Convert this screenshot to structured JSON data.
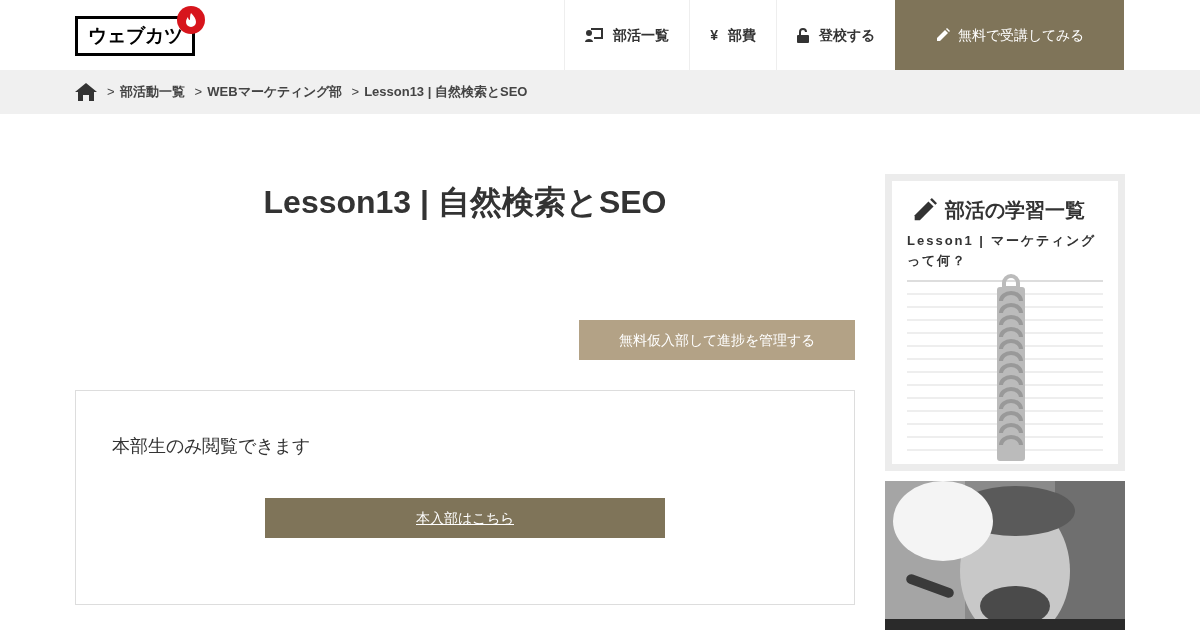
{
  "logo": {
    "text": "ウェブカツ"
  },
  "nav": [
    {
      "kind": "list",
      "label": "部活一覧"
    },
    {
      "kind": "yen",
      "glyph": "¥",
      "label": "部費"
    },
    {
      "kind": "lock",
      "label": "登校する"
    },
    {
      "kind": "cta",
      "label": "無料で受講してみる"
    }
  ],
  "breadcrumb": {
    "separator": ">",
    "items": [
      "部活動一覧",
      "WEBマーケティング部",
      "Lesson13 | 自然検索とSEO"
    ]
  },
  "title": "Lesson13 | 自然検索とSEO",
  "manage_button": "無料仮入部して進捗を管理する",
  "notice": "本部生のみ閲覧できます",
  "join_link": "本入部はこちら",
  "sidebar": {
    "title": "部活の学習一覧",
    "lesson": "Lesson1 | マーケティングって何？"
  }
}
